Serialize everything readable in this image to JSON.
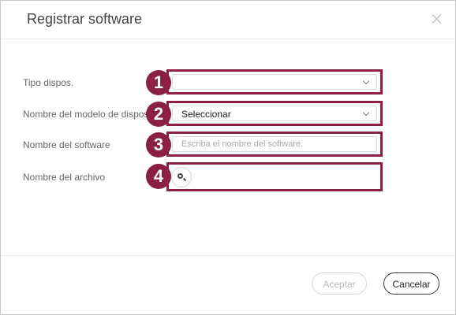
{
  "dialog": {
    "title": "Registrar software"
  },
  "form": {
    "device_type": {
      "label": "Tipo dispos.",
      "value": ""
    },
    "model_name": {
      "label": "Nombre del modelo de dispos",
      "value": "Seleccionar"
    },
    "software_name": {
      "label": "Nombre del software",
      "placeholder": "Escriba el nombre del software."
    },
    "file_name": {
      "label": "Nombre del archivo"
    }
  },
  "badges": [
    "1",
    "2",
    "3",
    "4"
  ],
  "buttons": {
    "accept": "Aceptar",
    "cancel": "Cancelar"
  },
  "colors": {
    "highlight": "#8b1f45"
  }
}
